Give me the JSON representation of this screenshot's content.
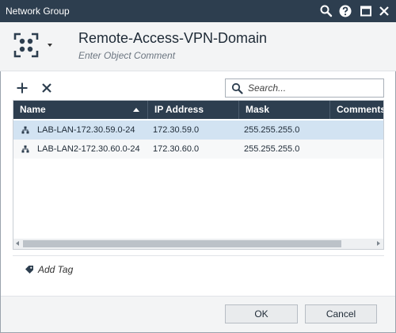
{
  "window": {
    "title": "Network Group"
  },
  "object": {
    "name": "Remote-Access-VPN-Domain",
    "comment_placeholder": "Enter Object Comment"
  },
  "toolbar": {
    "add_icon": "plus-icon",
    "remove_icon": "x-icon",
    "search_placeholder": "Search..."
  },
  "table": {
    "columns": [
      "Name",
      "IP Address",
      "Mask",
      "Comments"
    ],
    "sort_column": "Name",
    "rows": [
      {
        "name": "LAB-LAN-172.30.59.0-24",
        "ip": "172.30.59.0",
        "mask": "255.255.255.0",
        "comments": "",
        "selected": true
      },
      {
        "name": "LAB-LAN2-172.30.60.0-24",
        "ip": "172.30.60.0",
        "mask": "255.255.255.0",
        "comments": "",
        "selected": false
      }
    ]
  },
  "tags": {
    "add_label": "Add Tag"
  },
  "footer": {
    "ok_label": "OK",
    "cancel_label": "Cancel"
  },
  "colors": {
    "titlebar": "#2d3e4f",
    "selected_row": "#d2e3f2"
  }
}
